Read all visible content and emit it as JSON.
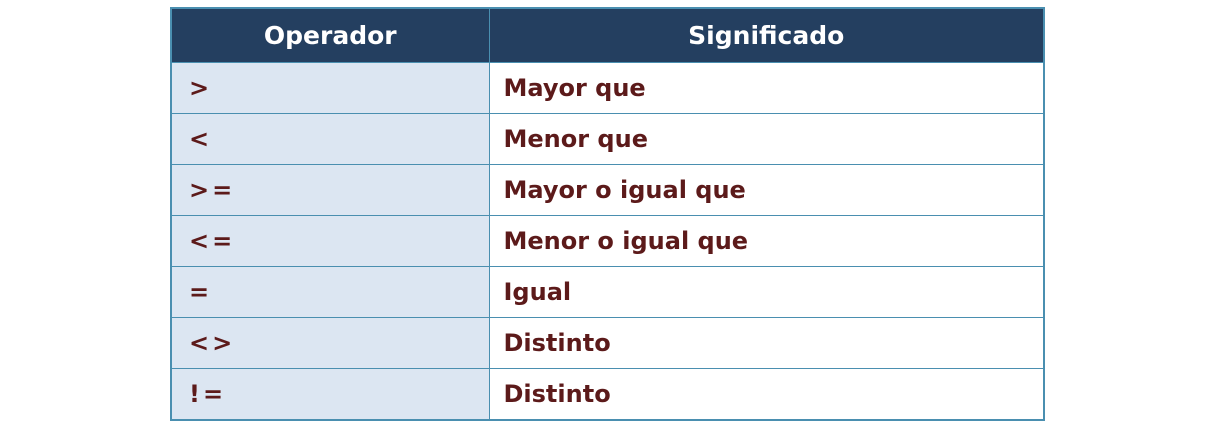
{
  "table": {
    "headers": [
      "Operador",
      "Significado"
    ],
    "rows": [
      {
        "operator": ">",
        "meaning": "Mayor que"
      },
      {
        "operator": "<",
        "meaning": "Menor que"
      },
      {
        "operator": ">=",
        "meaning": "Mayor o igual que"
      },
      {
        "operator": "<=",
        "meaning": "Menor o igual que"
      },
      {
        "operator": "=",
        "meaning": "Igual"
      },
      {
        "operator": "<>",
        "meaning": "Distinto"
      },
      {
        "operator": "!=",
        "meaning": "Distinto"
      }
    ]
  },
  "colors": {
    "header_bg": "#243f60",
    "header_text": "#ffffff",
    "operator_bg": "#dce6f2",
    "body_text": "#5c1a1a",
    "border": "#4a8fb0"
  }
}
